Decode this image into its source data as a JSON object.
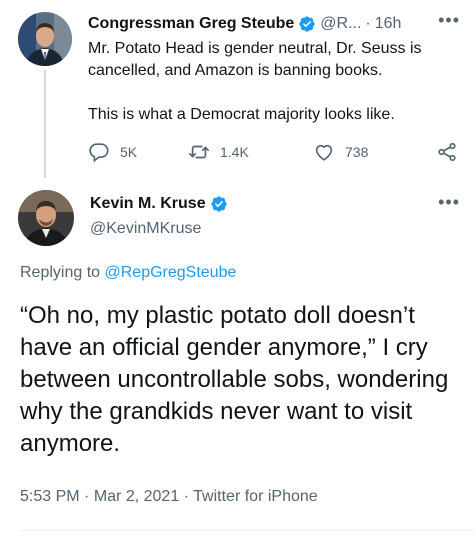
{
  "parent_tweet": {
    "author_name": "Congressman Greg Steube",
    "handle": "@R...",
    "separator": "·",
    "time": "16h",
    "more": "•••",
    "text_lines": [
      "Mr. Potato Head is gender neutral, Dr. Seuss is cancelled, and Amazon is banning books.",
      "This is what a Democrat majority looks like."
    ],
    "replies": "5K",
    "retweets": "1.4K",
    "likes": "738"
  },
  "main_tweet": {
    "author_name": "Kevin M. Kruse",
    "handle": "@KevinMKruse",
    "more": "•••",
    "replying_prefix": "Replying to",
    "replying_to": "@RepGregSteube",
    "text": "“Oh no, my plastic potato doll doesn’t have an official gender anymore,” I cry between uncontrollable sobs, wondering why the grandkids never want to visit anymore.",
    "time": "5:53 PM",
    "separator": "·",
    "date": "Mar 2, 2021",
    "source": "Twitter for iPhone"
  },
  "colors": {
    "accent": "#1d9bf0",
    "secondary_text": "#536471",
    "primary_text": "#0f1419"
  },
  "icons": [
    "verified-badge-icon",
    "reply-icon",
    "retweet-icon",
    "like-icon",
    "share-icon",
    "more-icon"
  ]
}
